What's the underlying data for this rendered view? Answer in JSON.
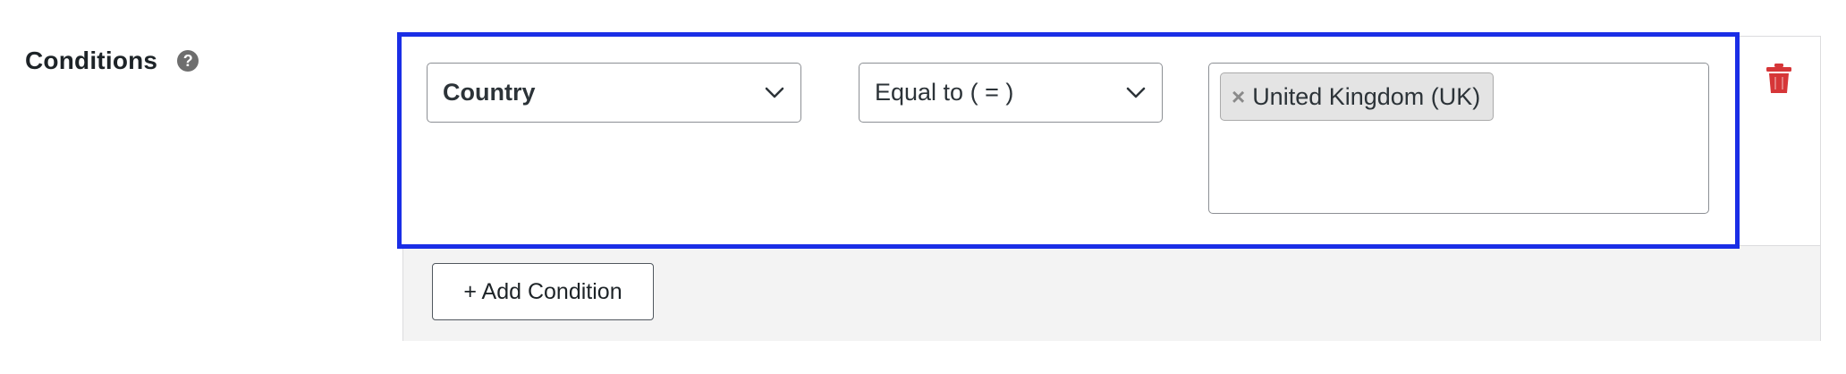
{
  "field": {
    "label": "Conditions",
    "help_icon_glyph": "?"
  },
  "condition": {
    "field_select": {
      "selected": "Country"
    },
    "operator_select": {
      "selected": "Equal to ( = )"
    },
    "values": [
      {
        "label": "United Kingdom (UK)",
        "remove_glyph": "×"
      }
    ]
  },
  "actions": {
    "add_condition_label": "+ Add Condition"
  },
  "icons": {
    "help": "question-circle-icon",
    "chevron": "chevron-down-icon",
    "delete": "trash-icon"
  },
  "colors": {
    "highlight_border": "#1a2ee6",
    "delete_icon": "#d63638",
    "footer_bg": "#f3f3f3"
  }
}
